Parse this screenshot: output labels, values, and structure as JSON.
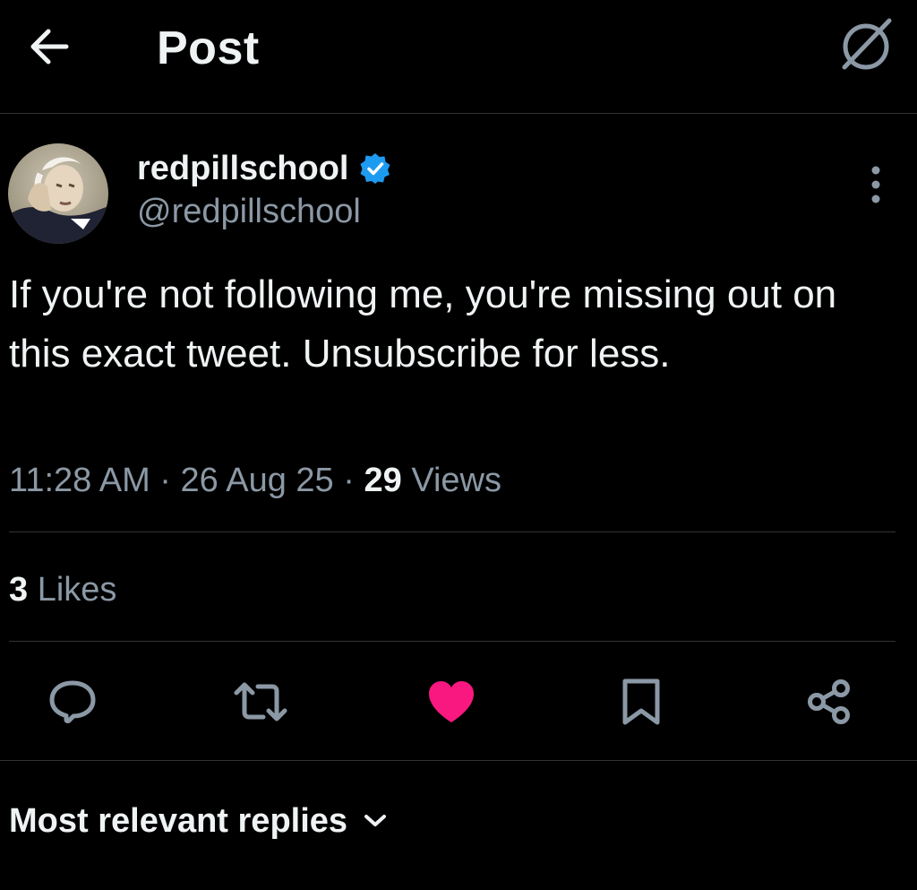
{
  "header": {
    "title": "Post",
    "back_icon": "arrow-left-icon",
    "grok_icon": "grok-icon"
  },
  "author": {
    "display_name": "redpillschool",
    "handle": "@redpillschool",
    "verified": true,
    "verified_color": "#1d9bf0"
  },
  "tweet": {
    "text": "If you're not following me, you're missing out on this exact tweet. Unsubscribe for less.",
    "time": "11:28 AM",
    "date": "26 Aug 25",
    "separator": "·",
    "views_count": "29",
    "views_label": "Views"
  },
  "stats": {
    "likes_count": "3",
    "likes_label": "Likes"
  },
  "actions": {
    "reply_icon": "reply-icon",
    "repost_icon": "repost-icon",
    "like_icon": "heart-icon",
    "like_active": true,
    "like_color": "#f91880",
    "bookmark_icon": "bookmark-icon",
    "share_icon": "share-icon"
  },
  "replies": {
    "sort_label": "Most relevant replies"
  },
  "colors": {
    "background": "#000000",
    "text_primary": "#eff3f4",
    "text_secondary": "#8b98a5",
    "divider": "#2f3336"
  }
}
